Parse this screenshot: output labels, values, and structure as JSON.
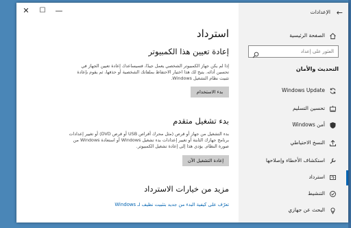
{
  "window": {
    "title": "الإعدادات",
    "back_glyph": "←",
    "minimize_glyph": "—",
    "maximize_glyph": "☐",
    "close_glyph": "✕"
  },
  "sidebar": {
    "home_label": "الصفحة الرئيسية",
    "search_placeholder": "العثور على إعداد",
    "section_title": "التحديث والأمان",
    "items": [
      {
        "label": "Windows Update",
        "icon": "sync-icon"
      },
      {
        "label": "تحسين التسليم",
        "icon": "delivery-optimization-icon"
      },
      {
        "label": "أمن Windows",
        "icon": "shield-icon"
      },
      {
        "label": "النسخ الاحتياطي",
        "icon": "backup-icon"
      },
      {
        "label": "استكشاف الأخطاء وإصلاحها",
        "icon": "wrench-icon"
      },
      {
        "label": "استرداد",
        "icon": "recovery-icon"
      },
      {
        "label": "التنشيط",
        "icon": "activation-icon"
      },
      {
        "label": "البحث عن جهازي",
        "icon": "find-device-icon"
      }
    ],
    "selected_item": "استرداد"
  },
  "main": {
    "title": "استرداد",
    "reset": {
      "heading": "إعادة تعيين هذا الكمبيوتر",
      "description": "إذا لم يكن جهاز الكمبيوتر الشخصي يعمل جيدًا، فسيساعدك إعادة تعيين الجهاز في تحسين أدائه. يتيح لك هذا اختيار الاحتفاظ بملفاتك الشخصية أو حذفها، ثم يقوم بإعادة تثبيت نظام التشغيل Windows.",
      "button": "بدء الاستخدام"
    },
    "advanced": {
      "heading": "بدء تشغيل متقدم",
      "description": "بدء التشغيل من جهاز أو قرص (مثل محرك أقراص USB أو قرص DVD) أو تغيير إعدادات برنامج جهازك الثابتة أو تغيير إعدادات بدء تشغيل Windows أو استعادة Windows من صورة النظام. يؤدي هذا إلى إعادة تشغيل الكمبيوتر.",
      "button": "إعادة التشغيل الآن"
    },
    "more": {
      "heading": "مزيد من خيارات الاسترداد",
      "link": "تعرّف على كيفية البدء من جديد بتثبيت نظيف لـ Windows"
    }
  },
  "colors": {
    "accent": "#0063b1",
    "sidebar_bg": "#f2f2f2",
    "button_bg": "#cccccc",
    "desktop": "#4a86b7"
  }
}
